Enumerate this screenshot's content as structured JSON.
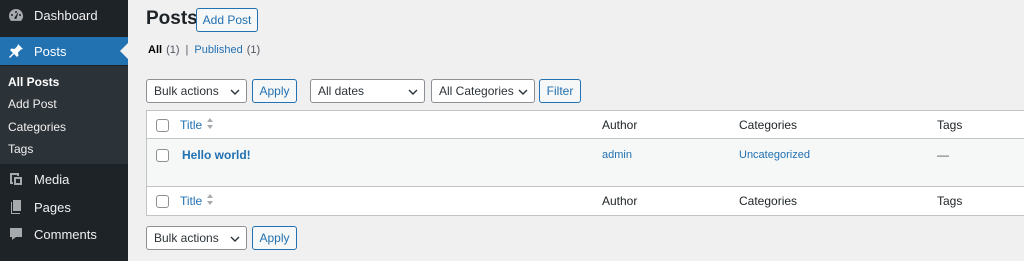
{
  "sidebar": {
    "items": [
      {
        "label": "Dashboard",
        "icon": "dashboard-icon"
      },
      {
        "label": "Posts",
        "icon": "pin-icon"
      },
      {
        "label": "Media",
        "icon": "media-icon"
      },
      {
        "label": "Pages",
        "icon": "pages-icon"
      },
      {
        "label": "Comments",
        "icon": "comments-icon"
      }
    ],
    "submenu": [
      "All Posts",
      "Add Post",
      "Categories",
      "Tags"
    ],
    "accent": "#2271b1",
    "background": "#1d2327"
  },
  "header": {
    "title": "Posts",
    "add_post_label": "Add Post"
  },
  "filters": {
    "all_label": "All",
    "all_count": "(1)",
    "separator": "|",
    "published_label": "Published",
    "published_count": "(1)"
  },
  "toolbar": {
    "bulk_actions": "Bulk actions",
    "apply_label": "Apply",
    "dates_selected": "All dates",
    "categories_selected": "All Categories",
    "filter_label": "Filter"
  },
  "table": {
    "columns": {
      "title": "Title",
      "author": "Author",
      "categories": "Categories",
      "tags": "Tags"
    },
    "rows": [
      {
        "title": "Hello world!",
        "author": "admin",
        "categories": "Uncategorized",
        "tags": "—"
      }
    ]
  },
  "bottom_toolbar": {
    "bulk_actions": "Bulk actions",
    "apply_label": "Apply"
  }
}
